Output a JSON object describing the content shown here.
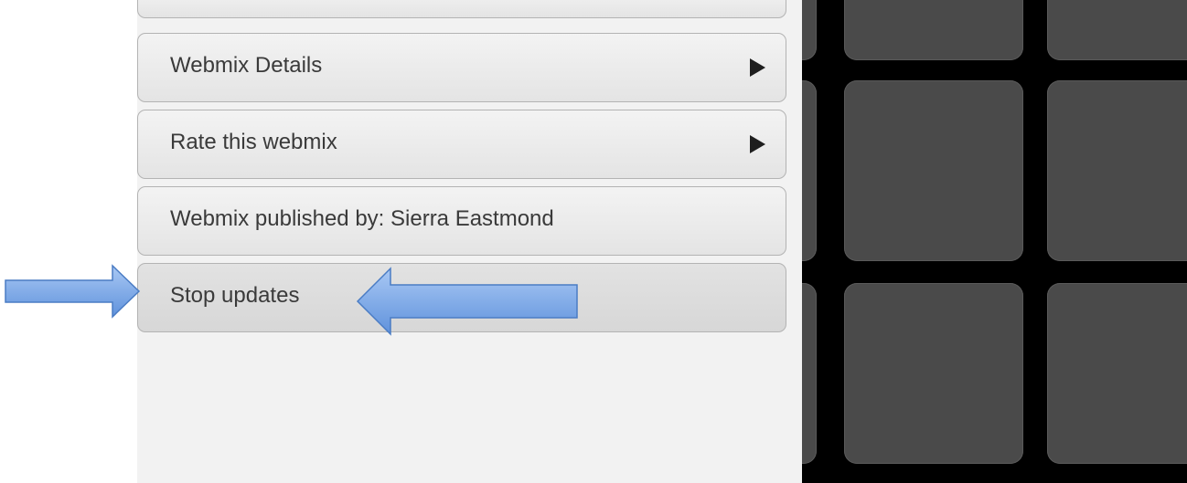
{
  "menu": {
    "items": [
      {
        "label": "Webmix Details"
      },
      {
        "label": "Rate this webmix"
      },
      {
        "label": "Webmix published by: Sierra Eastmond"
      },
      {
        "label": "Stop updates"
      }
    ]
  },
  "icons": {
    "chevron": "chevron-right-icon",
    "annotation_arrow": "arrow-icon"
  },
  "colors": {
    "panel_bg": "#f2f2f2",
    "button_bg": "#e9e9e9",
    "button_border": "#b3b3b3",
    "grid_bg": "#000000",
    "tile_bg": "#4a4a4a",
    "arrow_fill": "#7aa8e8",
    "arrow_stroke": "#4a7cc4"
  }
}
